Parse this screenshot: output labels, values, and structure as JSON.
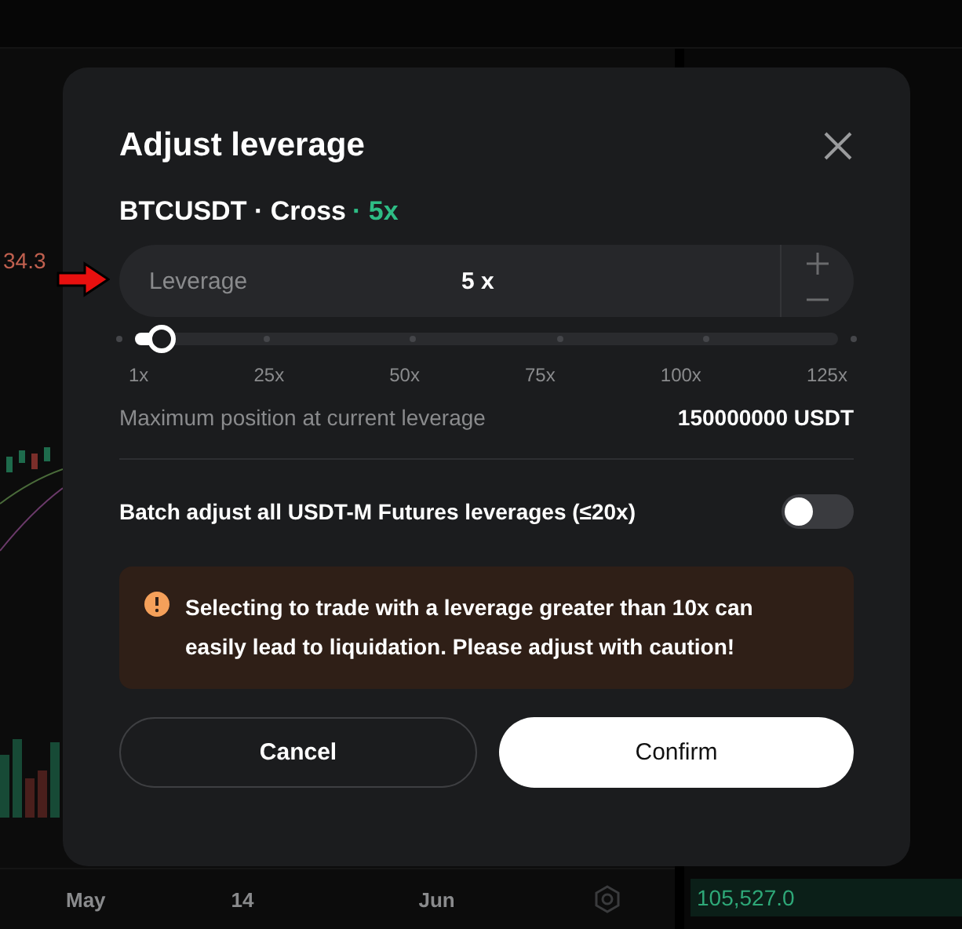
{
  "background": {
    "price_label": "34.3",
    "time_axis": [
      "May",
      "14",
      "Jun"
    ],
    "order_book_price": "105,527.0"
  },
  "dialog": {
    "title": "Adjust leverage",
    "symbol": "BTCUSDT ·",
    "margin_mode": "Cross",
    "leverage_tag": "· 5x",
    "field": {
      "label": "Leverage",
      "value": "5 x"
    },
    "slider": {
      "level": 0.032,
      "ticks": [
        "1x",
        "25x",
        "50x",
        "75x",
        "100x",
        "125x"
      ]
    },
    "max_position": {
      "label": "Maximum position at current leverage",
      "value": "150000000 USDT"
    },
    "batch": {
      "label": "Batch adjust all USDT-M Futures leverages (≤20x)",
      "on": false
    },
    "warning": "Selecting to trade with a leverage greater than 10x can easily lead to liquidation. Please adjust with caution!",
    "buttons": [
      {
        "label": "Cancel",
        "kind": "secondary"
      },
      {
        "label": "Confirm",
        "kind": "primary"
      }
    ]
  }
}
